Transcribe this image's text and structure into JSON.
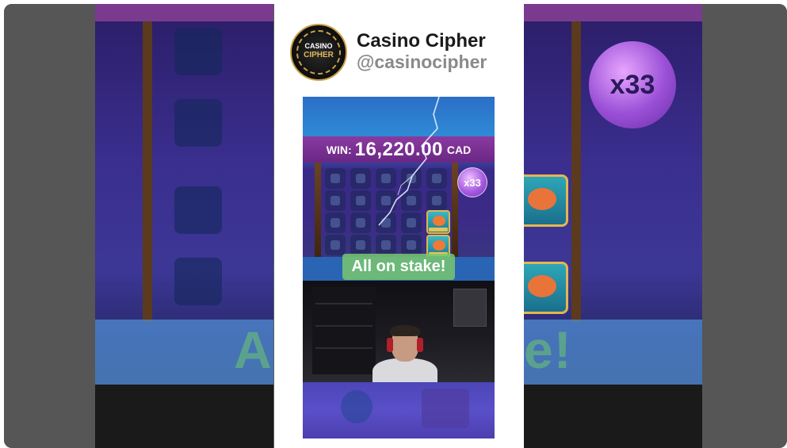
{
  "channel": {
    "name": "Casino Cipher",
    "handle": "@casinocipher",
    "avatar_top_text": "CASINO",
    "avatar_bottom_text": "CIPHER"
  },
  "video": {
    "win_label": "WIN:",
    "win_amount": "16,220.00",
    "win_currency": "CAD",
    "multiplier": "x33",
    "caption": "All on stake!"
  },
  "backdrop": {
    "multiplier": "x33",
    "caption_left": "A",
    "caption_right": "e!"
  },
  "colors": {
    "win_bar": "#7a3194",
    "caption_bg": "#7cc86e",
    "multiplier_bubble": "#a75be0"
  }
}
